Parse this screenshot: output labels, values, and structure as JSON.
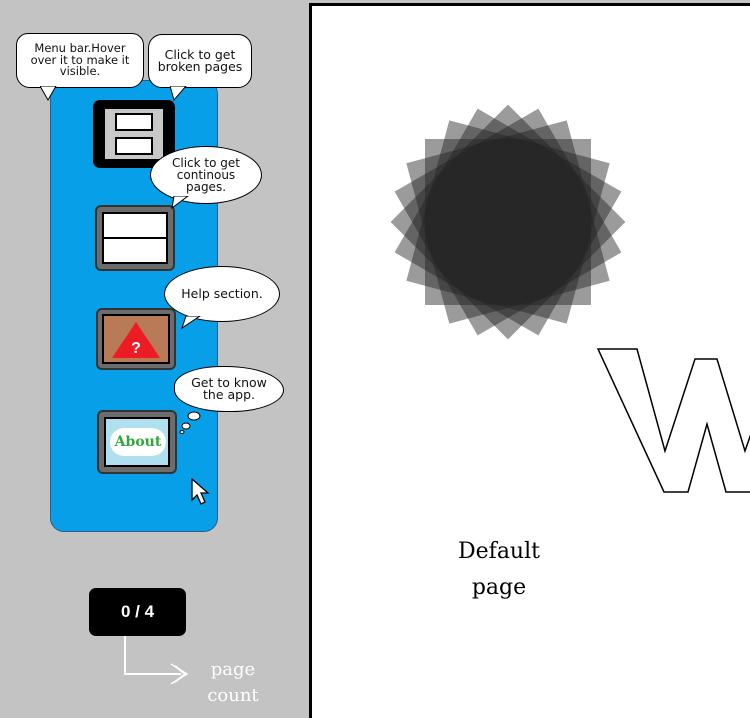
{
  "menu": {
    "buttons": [
      {
        "id": "broken",
        "tooltip": "Click to get broken pages"
      },
      {
        "id": "continuous",
        "tooltip": "Click to get continous pages."
      },
      {
        "id": "help",
        "tooltip": "Help section.",
        "glyph": "?"
      },
      {
        "id": "about",
        "label": "About",
        "tooltip": "Get to know the app."
      }
    ],
    "hint": "Menu bar.Hover over it to make it visible."
  },
  "page_count": {
    "value": "0 / 4",
    "annotation": "page count"
  },
  "main": {
    "label_line1": "Default",
    "label_line2": "page",
    "logo_letter": "W"
  },
  "colors": {
    "background": "#c3c3c3",
    "menu_bar": "#079fe7",
    "page": "#ffffff",
    "help_tile": "#b97a57",
    "help_triangle": "#ed1c24",
    "about_text": "#2fa83a"
  },
  "icons": [
    "save-disk-icon",
    "continuous-pages-icon",
    "help-triangle-icon",
    "about-cloud-icon",
    "spinner-icon",
    "pointer-cursor-icon",
    "arrow-annotation-icon"
  ]
}
